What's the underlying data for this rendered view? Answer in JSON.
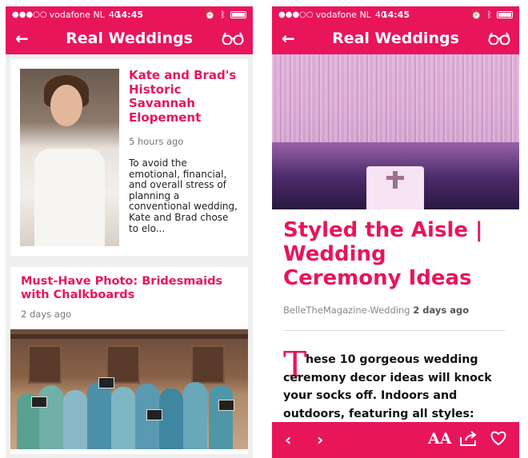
{
  "status": {
    "carrier": "vodafone NL",
    "network": "4G",
    "time": "14:45"
  },
  "left": {
    "nav_title": "Real Weddings",
    "cards": [
      {
        "headline": "Kate and Brad's Historic Savannah Elopement",
        "time": "5 hours ago",
        "excerpt": "To avoid the emotional, financial, and overall stress of planning a conventional wedding, Kate and Brad chose to elo..."
      },
      {
        "headline": "Must-Have Photo: Bridesmaids with Chalkboards",
        "time": "2 days ago"
      }
    ]
  },
  "right": {
    "nav_title": "Real Weddings",
    "article_title": "Styled the Aisle | Wedding Ceremony Ideas",
    "source": "BelleTheMagazine-Wedding",
    "time": "2 days ago",
    "dropcap": "T",
    "body": "hese 10 gorgeous wedding ceremony decor ideas will knock your socks off. Indoors and outdoors, featuring all styles:",
    "toolbar": {
      "font_size_label": "AA"
    }
  },
  "colors": {
    "accent": "#e8155b"
  },
  "icons": [
    "back-arrow-icon",
    "glasses-icon",
    "chevron-left-icon",
    "chevron-right-icon",
    "font-size-icon",
    "share-icon",
    "heart-icon",
    "bluetooth-icon",
    "alarm-icon",
    "battery-icon"
  ]
}
